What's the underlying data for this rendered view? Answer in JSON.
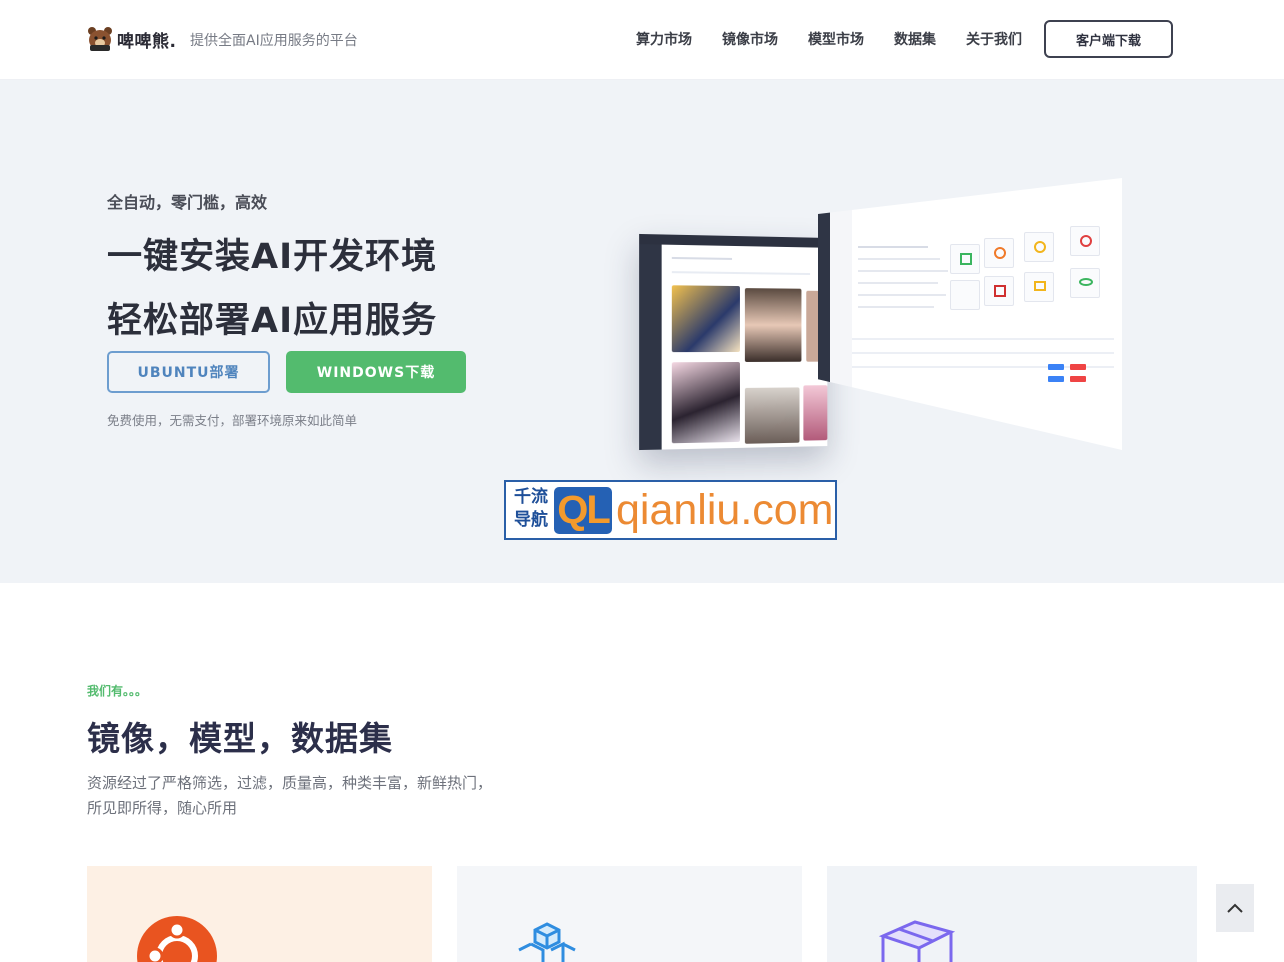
{
  "brand": {
    "name": "啤啤熊.",
    "tagline": "提供全面AI应用服务的平台"
  },
  "nav": {
    "items": [
      "算力市场",
      "镜像市场",
      "模型市场",
      "数据集",
      "关于我们"
    ],
    "download_button": "客户端下载"
  },
  "hero": {
    "kicker": "全自动，零门槛，高效",
    "title_line1": "一键安装AI开发环境",
    "title_line2": "轻松部署AI应用服务",
    "ubuntu_button": "UBUNTU部署",
    "windows_button": "WINDOWS下载",
    "note": "免费使用，无需支付，部署环境原来如此简单"
  },
  "badge": {
    "cn_line1": "千流",
    "cn_line2": "导航",
    "logo": "QL",
    "domain": "qianliu.com"
  },
  "section": {
    "kicker": "我们有。。。",
    "title": "镜像，模型，数据集",
    "desc_line1": "资源经过了严格筛选，过滤，质量高，种类丰富，新鲜热门，",
    "desc_line2": "所见即所得，随心所用"
  },
  "cards": [
    {
      "icon": "ubuntu-icon",
      "color": "#e95420"
    },
    {
      "icon": "cubes-icon",
      "color": "#2f8de0"
    },
    {
      "icon": "box-icon",
      "color": "#7b68ee"
    }
  ],
  "colors": {
    "accent_green": "#53bb6e",
    "accent_blue": "#4f84bd",
    "hero_bg": "#f0f3f7"
  }
}
